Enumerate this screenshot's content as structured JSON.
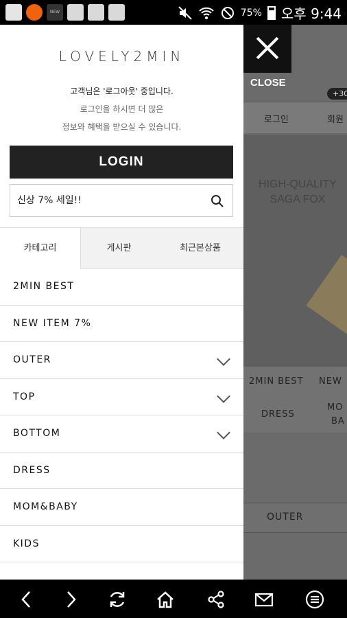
{
  "status_bar": {
    "battery_percent": "75%",
    "time": "오후 9:44",
    "notif_small_text": "NEW"
  },
  "drawer": {
    "brand": "LOVELY2MIN",
    "greeting_line1": "고객님은 '로그아웃' 중입니다.",
    "greeting_line2": "로그인을 하시면 더 많은",
    "greeting_line3": "정보와 혜택을 받으실 수 있습니다.",
    "login_label": "LOGIN",
    "search_value": "신상 7% 세일!!",
    "tabs": [
      {
        "label": "카테고리"
      },
      {
        "label": "게시판"
      },
      {
        "label": "최근본상품"
      }
    ],
    "menu": [
      {
        "label": "2MIN BEST"
      },
      {
        "label": "NEW ITEM 7%"
      },
      {
        "label": "OUTER"
      },
      {
        "label": "TOP"
      },
      {
        "label": "BOTTOM"
      },
      {
        "label": "DRESS"
      },
      {
        "label": "MOM&BABY"
      },
      {
        "label": "KIDS"
      }
    ]
  },
  "background": {
    "close_label": "CLOSE",
    "badge": "+30",
    "nav_login": "로그인",
    "nav_join": "회원",
    "hero_line1": "HIGH-QUALITY",
    "hero_line2": "SAGA FOX",
    "cat_2min_best": "2MIN BEST",
    "cat_new": "NEW",
    "cat_dress": "DRESS",
    "cat_mom1": "MO",
    "cat_mom2": "BA",
    "cat_outer": "OUTER"
  }
}
